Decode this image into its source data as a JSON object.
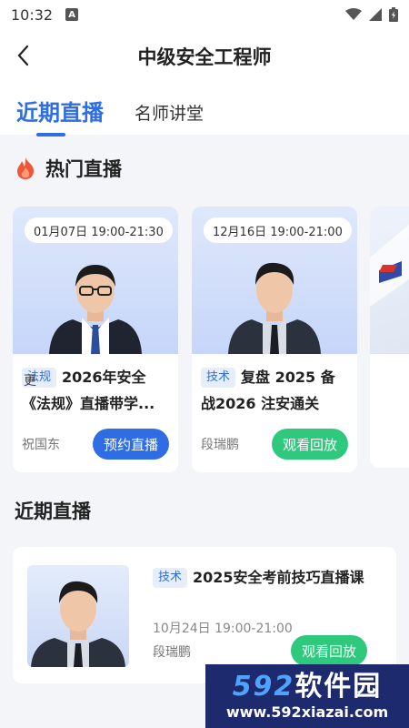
{
  "status_bar": {
    "time": "10:32",
    "notification_letter": "A"
  },
  "header": {
    "title": "中级安全工程师"
  },
  "tabs": [
    {
      "label": "近期直播",
      "active": true
    },
    {
      "label": "名师讲堂",
      "active": false
    }
  ],
  "hot": {
    "title": "热门直播",
    "cards": [
      {
        "date": "01月07日 19:00-21:30",
        "tag": "法规",
        "title": "2026年安全《法规》直播带学...",
        "teacher": "祝国东",
        "button": "预约直播",
        "button_color": "#2f6de4"
      },
      {
        "date": "12月16日 19:00-21:00",
        "tag": "技术",
        "title": "复盘 2025 备战2026 注安通关攻...",
        "teacher": "段瑞鹏",
        "button": "观看回放",
        "button_color": "#2ec97c"
      }
    ],
    "more_label": "更"
  },
  "recent": {
    "title": "近期直播",
    "item": {
      "tag": "技术",
      "title": "2025安全考前技巧直播课",
      "date": "10月24日 19:00-21:00",
      "teacher": "段瑞鹏",
      "button": "观看回放"
    }
  },
  "watermark": {
    "brand_num": "592",
    "brand_text": "软件园",
    "url": "www.592xiazai.com"
  },
  "colors": {
    "accent": "#2f6de4",
    "green": "#2ec97c",
    "background": "#f4f5f8"
  }
}
